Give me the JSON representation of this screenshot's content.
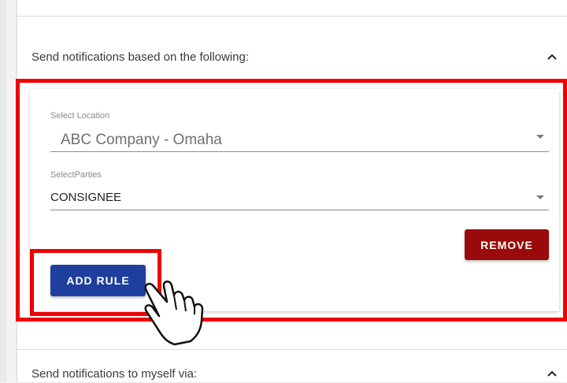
{
  "notifications_section": {
    "title": "Send notifications based on the following:",
    "expanded": true,
    "chevron_icon": "chevron-up-icon"
  },
  "rule": {
    "location": {
      "label": "Select Location",
      "value": "ABC Company - Omaha",
      "dropdown_icon": "dropdown-arrow-icon"
    },
    "parties": {
      "label": "SelectParties",
      "value": "CONSIGNEE",
      "dropdown_icon": "dropdown-arrow-icon"
    },
    "remove_label": "REMOVE"
  },
  "add_rule_label": "ADD RULE",
  "self_section": {
    "title": "Send notifications to myself via:",
    "chevron_icon": "chevron-up-icon"
  },
  "colors": {
    "highlight": "#ee0000",
    "remove_button": "#9b0a0a",
    "add_button": "#1f3f9e"
  },
  "annotation_icon": "pointing-hand-cursor-icon"
}
